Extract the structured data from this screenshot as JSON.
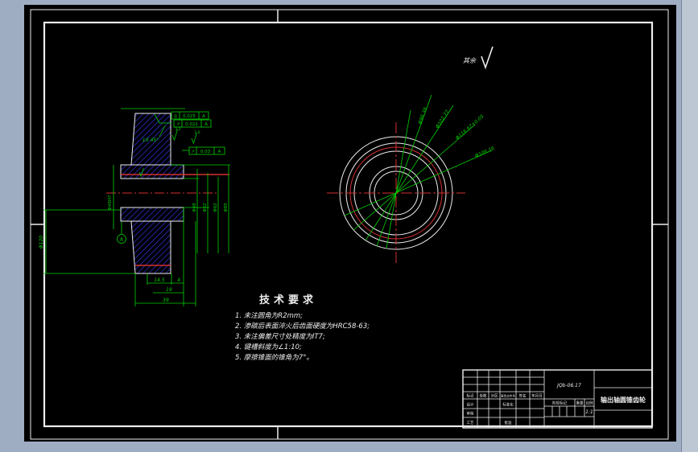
{
  "colors": {
    "background": "#9fadc2",
    "paper": "#000000",
    "dimension_green": "#00d200",
    "centerline_red": "#d43030",
    "hatch_blue": "#3232e6",
    "line_white": "#ededed"
  },
  "surface_note": {
    "prefix": "其余",
    "symbol": "roughness-check"
  },
  "tech_requirements": {
    "title": "技术要求",
    "items": [
      "1. 未注圆角为R2mm;",
      "2. 渗碳后表面淬火后齿面硬度为HRC58-63;",
      "3. 未注偏差尺寸处精度为IT7;",
      "4. 键槽斜度为∠1:10;",
      "5. 摩擦锥面的锥角为7°。"
    ]
  },
  "section_view": {
    "chamfer": "1X 45°",
    "datum": "A",
    "roughness": [
      "3.2",
      "1.6"
    ],
    "fcf": [
      {
        "sym": "◎",
        "tol": "0.025",
        "datum": "A"
      },
      {
        "sym": "↗",
        "tol": "0.022",
        "datum": "A"
      },
      {
        "sym": "↗",
        "tol": "0.03",
        "datum": "A"
      }
    ],
    "dia_dims": [
      "Φ45H7",
      "Φ48",
      "Φ52",
      "Φ62",
      "Φ85",
      "Φ120"
    ],
    "width_dims": [
      "14.5",
      "4",
      "19",
      "39"
    ]
  },
  "front_view": {
    "radial_dims": [
      "Φ98.39",
      "Φ102.77",
      "Φ116.67±0.05",
      "Φ106.16"
    ]
  },
  "title_block": {
    "drawing_no": "JQb-06.17",
    "part_name": "输出轴圆锥齿轮",
    "scale": "1:1",
    "labels": {
      "mark": "标记",
      "count": "处数",
      "zone": "分区",
      "change_doc": "更改文件号",
      "sign": "签名",
      "date": "年月日",
      "design": "设计",
      "standardize": "标准化",
      "check": "审核",
      "process": "工艺",
      "approve": "批准",
      "stage": "阶段标记",
      "weight": "重量",
      "scale_label": "比例"
    }
  }
}
